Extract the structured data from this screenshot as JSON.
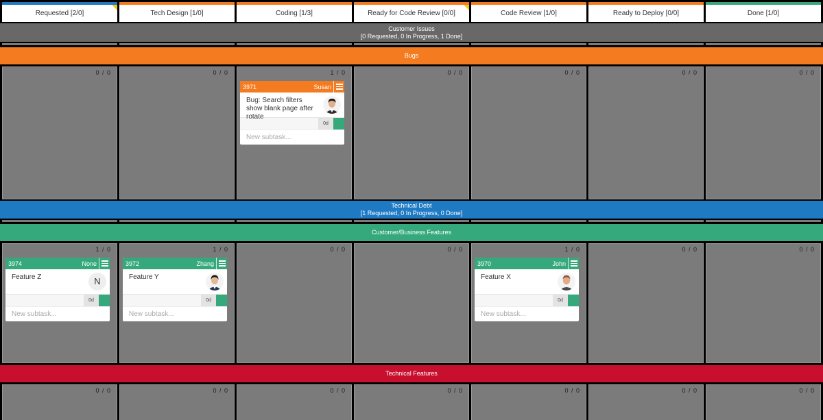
{
  "columns": [
    {
      "label": "Requested [2/0]",
      "accent": "#1f7ac4",
      "flag": true
    },
    {
      "label": "Tech Design [1/0]",
      "accent": "#f47b20",
      "flag": false
    },
    {
      "label": "Coding [1/3]",
      "accent": "#f47b20",
      "flag": false
    },
    {
      "label": "Ready for Code Review [0/0]",
      "accent": "#f47b20",
      "flag": true
    },
    {
      "label": "Code Review [1/0]",
      "accent": "#f47b20",
      "flag": false
    },
    {
      "label": "Ready to Deploy [0/0]",
      "accent": "#f47b20",
      "flag": false
    },
    {
      "label": "Done [1/0]",
      "accent": "#35a97c",
      "flag": false
    }
  ],
  "lanes": {
    "customer_issues": {
      "title": "Customer Issues",
      "subtitle": "[0 Requested, 0 In Progress, 1 Done]",
      "color": "#686868"
    },
    "bugs": {
      "title": "Bugs",
      "color": "#f47b20"
    },
    "technical_debt": {
      "title": "Technical Debt",
      "subtitle": "[1 Requested, 0 In Progress, 0 Done]",
      "color": "#1f7ac4"
    },
    "customer_business_features": {
      "title": "Customer/Business Features",
      "color": "#35a97c"
    },
    "technical_features": {
      "title": "Technical Features",
      "color": "#c8102e"
    }
  },
  "counts": {
    "bugs": [
      "0 / 0",
      "0 / 0",
      "1 / 0",
      "0 / 0",
      "0 / 0",
      "0 / 0",
      "0 / 0"
    ],
    "features": [
      "1 / 0",
      "1 / 0",
      "0 / 0",
      "0 / 0",
      "1 / 0",
      "0 / 0",
      "0 / 0"
    ],
    "technical": [
      "0 / 0",
      "0 / 0",
      "0 / 0",
      "0 / 0",
      "0 / 0",
      "0 / 0",
      "0 / 0"
    ]
  },
  "cards": {
    "c3971": {
      "id": "3971",
      "owner": "Susan",
      "title": "Bug: Search filters show blank page after rotate",
      "age": "0d",
      "subtask_placeholder": "New subtask...",
      "color": "#f47b20",
      "status_color": "#35a97c"
    },
    "c3974": {
      "id": "3974",
      "owner": "None",
      "title": "Feature Z",
      "avatar_letter": "N",
      "age": "0d",
      "subtask_placeholder": "New subtask...",
      "color": "#35a97c",
      "status_color": "#35a97c"
    },
    "c3972": {
      "id": "3972",
      "owner": "Zhang",
      "title": "Feature Y",
      "age": "0d",
      "subtask_placeholder": "New subtask...",
      "color": "#35a97c",
      "status_color": "#35a97c"
    },
    "c3970": {
      "id": "3970",
      "owner": "John",
      "title": "Feature X",
      "age": "0d",
      "subtask_placeholder": "New subtask...",
      "color": "#35a97c",
      "status_color": "#35a97c"
    }
  }
}
